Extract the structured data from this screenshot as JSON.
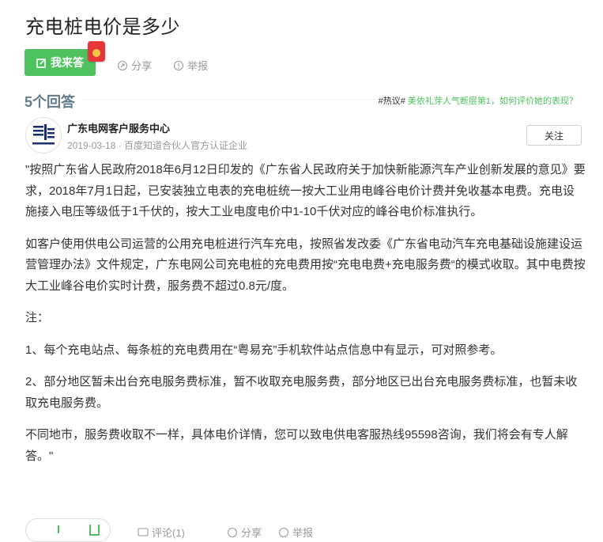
{
  "question": {
    "title": "充电桩电价是多少"
  },
  "actions": {
    "answer_label": "我来答",
    "share_label": "分享",
    "report_label": "举报"
  },
  "answers_header": {
    "count_label": "5个回答",
    "hot_tag": "#热议#",
    "hot_link": "美依礼芽人气断层第1，如何评价她的表现？"
  },
  "answer": {
    "author_name": "广东电网客户服务中心",
    "meta": "2019-03-18 · 百度知道合伙人官方认证企业",
    "follow_label": "关注",
    "paragraphs": [
      "\"按照广东省人民政府2018年6月12日印发的《广东省人民政府关于加快新能源汽车产业创新发展的意见》要求，2018年7月1日起，已安装独立电表的充电桩统一按大工业用电峰谷电价计费并免收基本电费。充电设施接入电压等级低于1千伏的，按大工业电度电价中1-10千伏对应的峰谷电价标准执行。",
      "如客户使用供电公司运营的公用充电桩进行汽车充电，按照省发改委《广东省电动汽车充电基础设施建设运营管理办法》文件规定，广东电网公司充电桩的充电费用按“充电电费+充电服务费“的模式收取。其中电费按大工业峰谷电价实时计费，服务费不超过0.8元/度。",
      "注：",
      "1、每个充电站点、每条桩的充电费用在“粤易充”手机软件站点信息中有显示，可对照参考。",
      "2、部分地区暂未出台充电服务费标准，暂不收取充电服务费，部分地区已出台充电服务费标准，也暂未收取充电服务费。",
      "不同地市，服务费收取不一样，具体电价详情，您可以致电供电客服热线95598咨询，我们将会有专人解答。\""
    ]
  },
  "bottom_bar": {
    "comment_label": "评论(1)",
    "share_label": "分享",
    "report_label": "举报"
  },
  "colors": {
    "green": "#4fc25f",
    "count_gray": "#637a8a",
    "red_packet": "#e8373a"
  }
}
